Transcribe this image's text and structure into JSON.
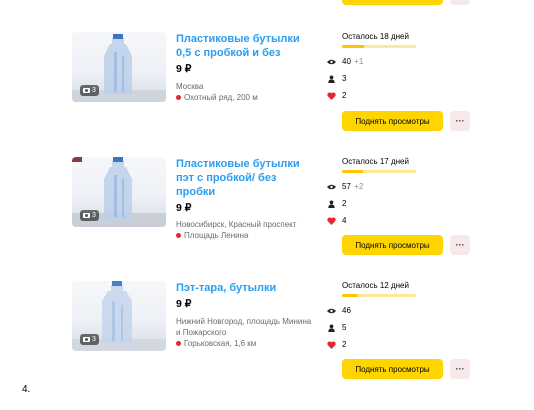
{
  "listings": [
    {
      "title": "Пластиковые бутылки 0,5 с пробкой и без",
      "price": "9 ₽",
      "city": "Москва",
      "metro": "Охотный ряд, 200 м",
      "photos": "3",
      "remaining": "Осталось 18 дней",
      "remaining_fraction": 0.3,
      "views": "40",
      "views_delta": "+1",
      "contacts": "3",
      "favorites": "2",
      "raise_label": "Поднять просмотры",
      "more_label": "···"
    },
    {
      "title": "Пластиковые бутылки пэт с пробкой/ без пробки",
      "price": "9 ₽",
      "city": "Новосибирск, Красный проспект",
      "metro": "Площадь Ленина",
      "photos": "3",
      "remaining": "Осталось 17 дней",
      "remaining_fraction": 0.28,
      "views": "57",
      "views_delta": "+2",
      "contacts": "2",
      "favorites": "4",
      "raise_label": "Поднять просмотры",
      "more_label": "···"
    },
    {
      "title": "Пэт-тара, бутылки",
      "price": "9 ₽",
      "city": "Нижний Новгород, площадь Минина и Пожарского",
      "metro": "Горьковская, 1,6 км",
      "photos": "3",
      "remaining": "Осталось 12 дней",
      "remaining_fraction": 0.2,
      "views": "46",
      "views_delta": "",
      "contacts": "5",
      "favorites": "2",
      "raise_label": "Поднять просмотры",
      "more_label": "···"
    }
  ],
  "page_number": "4.",
  "colors": {
    "title_link": "#2b9ef0",
    "accent_button": "#ffd500",
    "progress_fill": "#ffc300",
    "progress_track": "#fde89a",
    "favorite_heart": "#e3262f",
    "metro_dot": "#e3262f",
    "more_button_bg": "#f7e8ea"
  },
  "icons": {
    "views": "eye-icon",
    "contacts": "person-icon",
    "favorites": "heart-icon",
    "photos": "camera-icon",
    "metro": "metro-dot-icon"
  }
}
